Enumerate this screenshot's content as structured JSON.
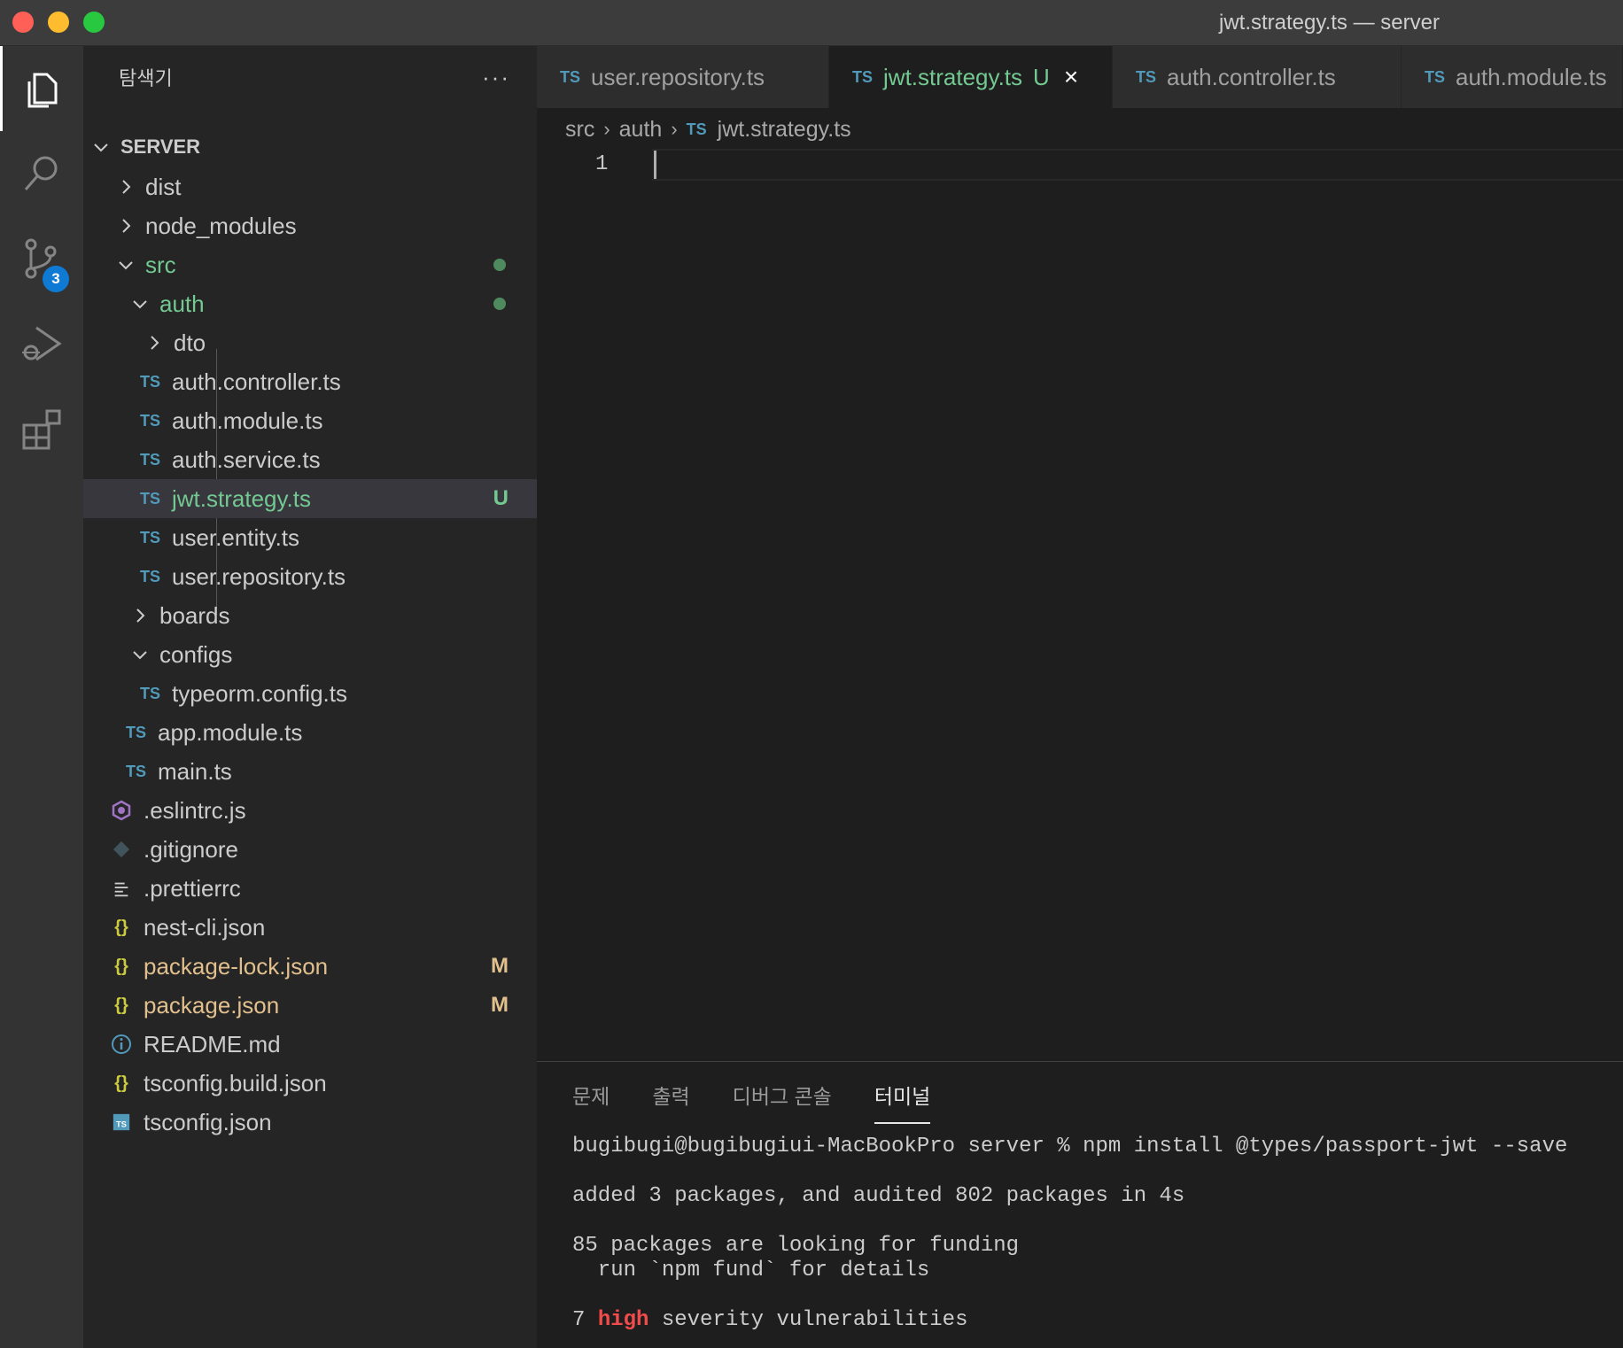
{
  "window": {
    "title": "jwt.strategy.ts — server"
  },
  "activity_bar": {
    "items": [
      "files-icon",
      "search-icon",
      "source-control-icon",
      "run-debug-icon",
      "extensions-icon"
    ],
    "source_control_badge": "3"
  },
  "sidebar": {
    "title": "탐색기",
    "more_label": "···",
    "root": "SERVER",
    "tree": [
      {
        "label": "dist",
        "kind": "folder",
        "expanded": false
      },
      {
        "label": "node_modules",
        "kind": "folder",
        "expanded": false
      },
      {
        "label": "src",
        "kind": "folder",
        "expanded": true,
        "decoration": "dot"
      },
      {
        "label": "auth",
        "kind": "folder",
        "expanded": true,
        "decoration": "dot"
      },
      {
        "label": "dto",
        "kind": "folder",
        "expanded": false
      },
      {
        "label": "auth.controller.ts",
        "kind": "ts"
      },
      {
        "label": "auth.module.ts",
        "kind": "ts"
      },
      {
        "label": "auth.service.ts",
        "kind": "ts"
      },
      {
        "label": "jwt.strategy.ts",
        "kind": "ts",
        "decoration": "U",
        "selected": true
      },
      {
        "label": "user.entity.ts",
        "kind": "ts"
      },
      {
        "label": "user.repository.ts",
        "kind": "ts"
      },
      {
        "label": "boards",
        "kind": "folder",
        "expanded": false
      },
      {
        "label": "configs",
        "kind": "folder",
        "expanded": true
      },
      {
        "label": "typeorm.config.ts",
        "kind": "ts"
      },
      {
        "label": "app.module.ts",
        "kind": "ts"
      },
      {
        "label": "main.ts",
        "kind": "ts"
      },
      {
        "label": ".eslintrc.js",
        "kind": "eslint"
      },
      {
        "label": ".gitignore",
        "kind": "git"
      },
      {
        "label": ".prettierrc",
        "kind": "lines"
      },
      {
        "label": "nest-cli.json",
        "kind": "json"
      },
      {
        "label": "package-lock.json",
        "kind": "json",
        "decoration": "M"
      },
      {
        "label": "package.json",
        "kind": "json",
        "decoration": "M"
      },
      {
        "label": "README.md",
        "kind": "info"
      },
      {
        "label": "tsconfig.build.json",
        "kind": "json"
      },
      {
        "label": "tsconfig.json",
        "kind": "tsconfig"
      }
    ]
  },
  "tabs": [
    {
      "label": "user.repository.ts",
      "icon": "TS"
    },
    {
      "label": "jwt.strategy.ts",
      "icon": "TS",
      "active": true,
      "status": "U"
    },
    {
      "label": "auth.controller.ts",
      "icon": "TS"
    },
    {
      "label": "auth.module.ts",
      "icon": "TS"
    }
  ],
  "breadcrumbs": {
    "part1": "src",
    "part2": "auth",
    "icon": "TS",
    "file": "jwt.strategy.ts"
  },
  "editor": {
    "line_number": "1"
  },
  "panel": {
    "tabs": [
      "문제",
      "출력",
      "디버그 콘솔",
      "터미널"
    ],
    "terminal": {
      "line1": "bugibugi@bugibugiui-MacBookPro server % npm install @types/passport-jwt --save",
      "line2": "added 3 packages, and audited 802 packages in 4s",
      "line3": "85 packages are looking for funding",
      "line4": "  run `npm fund` for details",
      "line5_count": "7",
      "line5_level": "high",
      "line5_rest": "severity vulnerabilities"
    }
  },
  "colors": {
    "untracked": "#73c991",
    "modified": "#e2c08d",
    "ts_icon": "#519aba",
    "badge": "#0e7ad4",
    "high_severity": "#f14c4c"
  }
}
